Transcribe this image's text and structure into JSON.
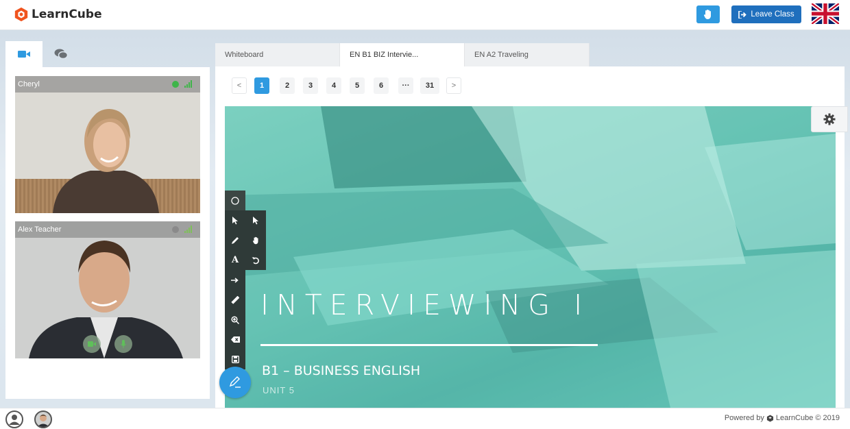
{
  "app": {
    "name": "LearnCube"
  },
  "header": {
    "leave_label": "Leave Class",
    "raise_hand_icon": "hand-icon",
    "flag_icon": "uk-flag-icon"
  },
  "left_panel": {
    "tabs": [
      {
        "icon": "video-camera-icon",
        "active": true
      },
      {
        "icon": "chat-icon",
        "active": false
      }
    ],
    "participants": [
      {
        "name": "Cheryl",
        "status_color": "#3fb54a"
      },
      {
        "name": "Alex Teacher",
        "status_color": "#8a8a8a"
      }
    ]
  },
  "main": {
    "tabs": [
      {
        "label": "Whiteboard"
      },
      {
        "label": "EN B1 BIZ Intervie..."
      },
      {
        "label": "EN A2 Traveling"
      }
    ],
    "pager": {
      "prev": "<",
      "pages": [
        "1",
        "2",
        "3",
        "4",
        "5",
        "6",
        "···",
        "31"
      ],
      "current": "1",
      "next": ">"
    },
    "slide": {
      "title": "INTERVIEWING I",
      "subtitle": "B1 – BUSINESS ENGLISH",
      "unit": "UNIT 5"
    }
  },
  "footer": {
    "powered_text": "Powered by",
    "brand": "LearnCube",
    "copyright": "© 2019"
  },
  "colors": {
    "accent": "#2f9ae0",
    "leave": "#1f6fbd",
    "slide": "#63c1b2",
    "logo": "#f0541e"
  }
}
